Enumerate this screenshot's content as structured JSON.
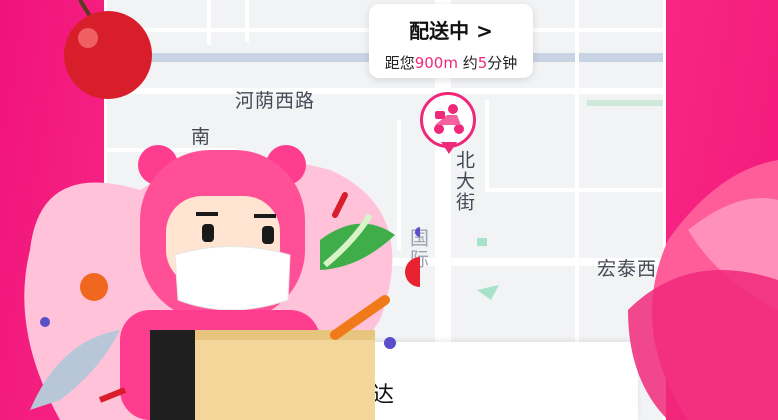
{
  "delivery": {
    "status": "配送中 >",
    "prefix": "距您",
    "distance": "900m",
    "middle": " 约",
    "minutes": "5",
    "suffix": "分钟"
  },
  "roads": {
    "henanxi": "河荫西路",
    "nan": "南",
    "beidajie": "北大街",
    "hongtai": "宏泰西",
    "guoji": "国际"
  },
  "bottom": {
    "partial_text": "达"
  },
  "colors": {
    "accent": "#f0287a",
    "brand_pink": "#f0127a",
    "map_bg": "#f2f3f5"
  }
}
